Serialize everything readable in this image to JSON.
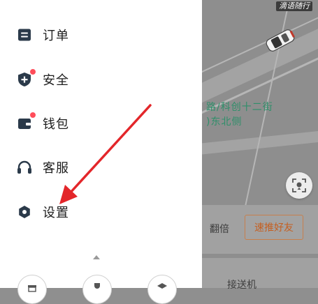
{
  "menu": {
    "items": [
      {
        "label": "订单",
        "icon": "order-list-icon",
        "badge": false
      },
      {
        "label": "安全",
        "icon": "shield-plus-icon",
        "badge": true
      },
      {
        "label": "钱包",
        "icon": "wallet-icon",
        "badge": true
      },
      {
        "label": "客服",
        "icon": "headset-icon",
        "badge": false
      },
      {
        "label": "设置",
        "icon": "gear-icon",
        "badge": false
      }
    ]
  },
  "map": {
    "watermark": "滴语随行",
    "street_line1": "路/科创十二街",
    "street_line2": ")东北侧"
  },
  "share_card": {
    "text": "翻倍",
    "button": "速推好友"
  },
  "tab_card": {
    "text": "接送机"
  },
  "colors": {
    "accent_red": "#ff4d5a",
    "menu_icon": "#2b3a4a",
    "share_border": "#c67f4c",
    "street_text": "#2f8f6a",
    "annotation_arrow": "#e3262a"
  }
}
